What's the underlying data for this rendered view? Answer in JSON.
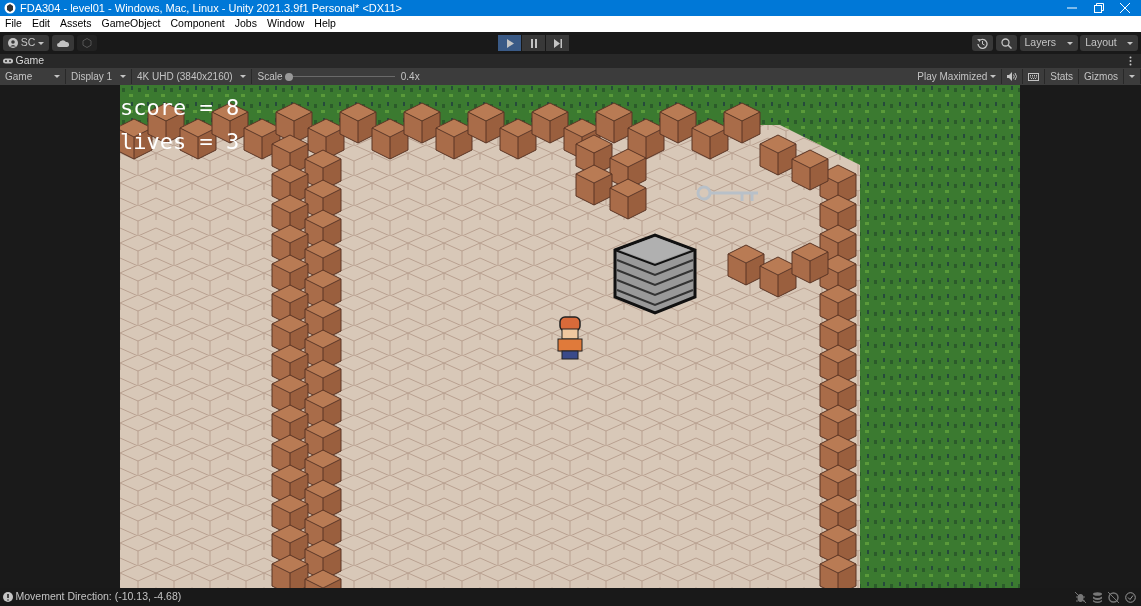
{
  "window": {
    "title": "FDA304 - level01 - Windows, Mac, Linux - Unity 2021.3.9f1 Personal* <DX11>"
  },
  "menu": [
    "File",
    "Edit",
    "Assets",
    "GameObject",
    "Component",
    "Jobs",
    "Window",
    "Help"
  ],
  "toolbar": {
    "account": "SC",
    "play_controls": [
      {
        "kind": "play",
        "selected": true
      },
      {
        "kind": "pause",
        "selected": false
      },
      {
        "kind": "step",
        "selected": false
      }
    ],
    "layers": "Layers",
    "layout": "Layout"
  },
  "tabs": [
    {
      "label": "Game",
      "selected": true
    }
  ],
  "game_toolbar": {
    "view": "Game",
    "display": "Display 1",
    "resolution": "4K UHD (3840x2160)",
    "scale_label": "Scale",
    "scale": {
      "level": 0.0
    },
    "scale_value": "0.4x",
    "play_mode": "Play Maximized",
    "stats": "Stats",
    "gizmos": "Gizmos"
  },
  "hud": [
    "score = 8",
    "lives = 3"
  ],
  "status_bar": {
    "message": "Movement Direction: (-10.13, -4.68)"
  }
}
